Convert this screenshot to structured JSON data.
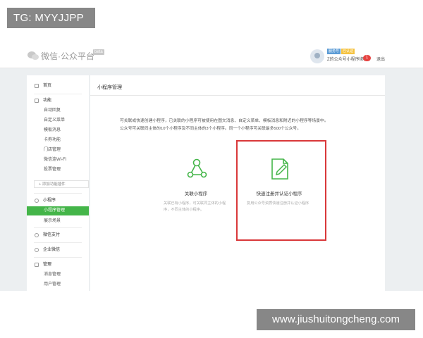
{
  "overlays": {
    "tag": "TG: MYYJJPP",
    "watermark": "www.jiushuitongcheng.com"
  },
  "header": {
    "logo_text": "微信·公众平台",
    "logo_badge": "beta",
    "account_tag_1": "服务号",
    "account_tag_2": "已认证",
    "account_name": "Z的公众号小程序绑定",
    "notification_count": "1",
    "logout_label": "退出"
  },
  "sidebar": {
    "items": [
      {
        "label": "首页",
        "kind": "group"
      },
      {
        "label": "功能",
        "kind": "group"
      },
      {
        "label": "自动回复",
        "kind": "sub"
      },
      {
        "label": "自定义菜单",
        "kind": "sub"
      },
      {
        "label": "模板消息",
        "kind": "sub"
      },
      {
        "label": "卡券功能",
        "kind": "sub"
      },
      {
        "label": "门店管理",
        "kind": "sub"
      },
      {
        "label": "微信连Wi-Fi",
        "kind": "sub"
      },
      {
        "label": "投票管理",
        "kind": "sub"
      },
      {
        "label": "+ 添加功能插件",
        "kind": "add"
      },
      {
        "label": "小程序",
        "kind": "group"
      },
      {
        "label": "小程序管理",
        "kind": "sub-active"
      },
      {
        "label": "展示场景",
        "kind": "sub"
      },
      {
        "label": "微信支付",
        "kind": "group"
      },
      {
        "label": "企业微信",
        "kind": "group"
      },
      {
        "label": "管理",
        "kind": "group"
      },
      {
        "label": "消息管理",
        "kind": "sub"
      },
      {
        "label": "用户管理",
        "kind": "sub"
      }
    ]
  },
  "main": {
    "page_title": "小程序管理",
    "description_line_1": "可关联或快速创建小程序，已关联的小程序可被使用在图文消息、自定义菜单、模板消息和附近的小程序等场景中。",
    "description_line_2": "公众号可关联同主体的10个小程序及不同主体的3个小程序。同一个小程序可关联最多500个公众号。",
    "cards": [
      {
        "title": "关联小程序",
        "desc": "关联已有小程序，可关联同主体的小程序，不同主体的小程序。",
        "icon": "share-nodes-icon"
      },
      {
        "title": "快速注册并认证小程序",
        "desc": "复用公众号资质快速注册并认证小程序",
        "icon": "document-edit-icon"
      }
    ]
  },
  "colors": {
    "accent": "#44b549",
    "highlight": "#d9383a",
    "background": "#eceff1"
  }
}
